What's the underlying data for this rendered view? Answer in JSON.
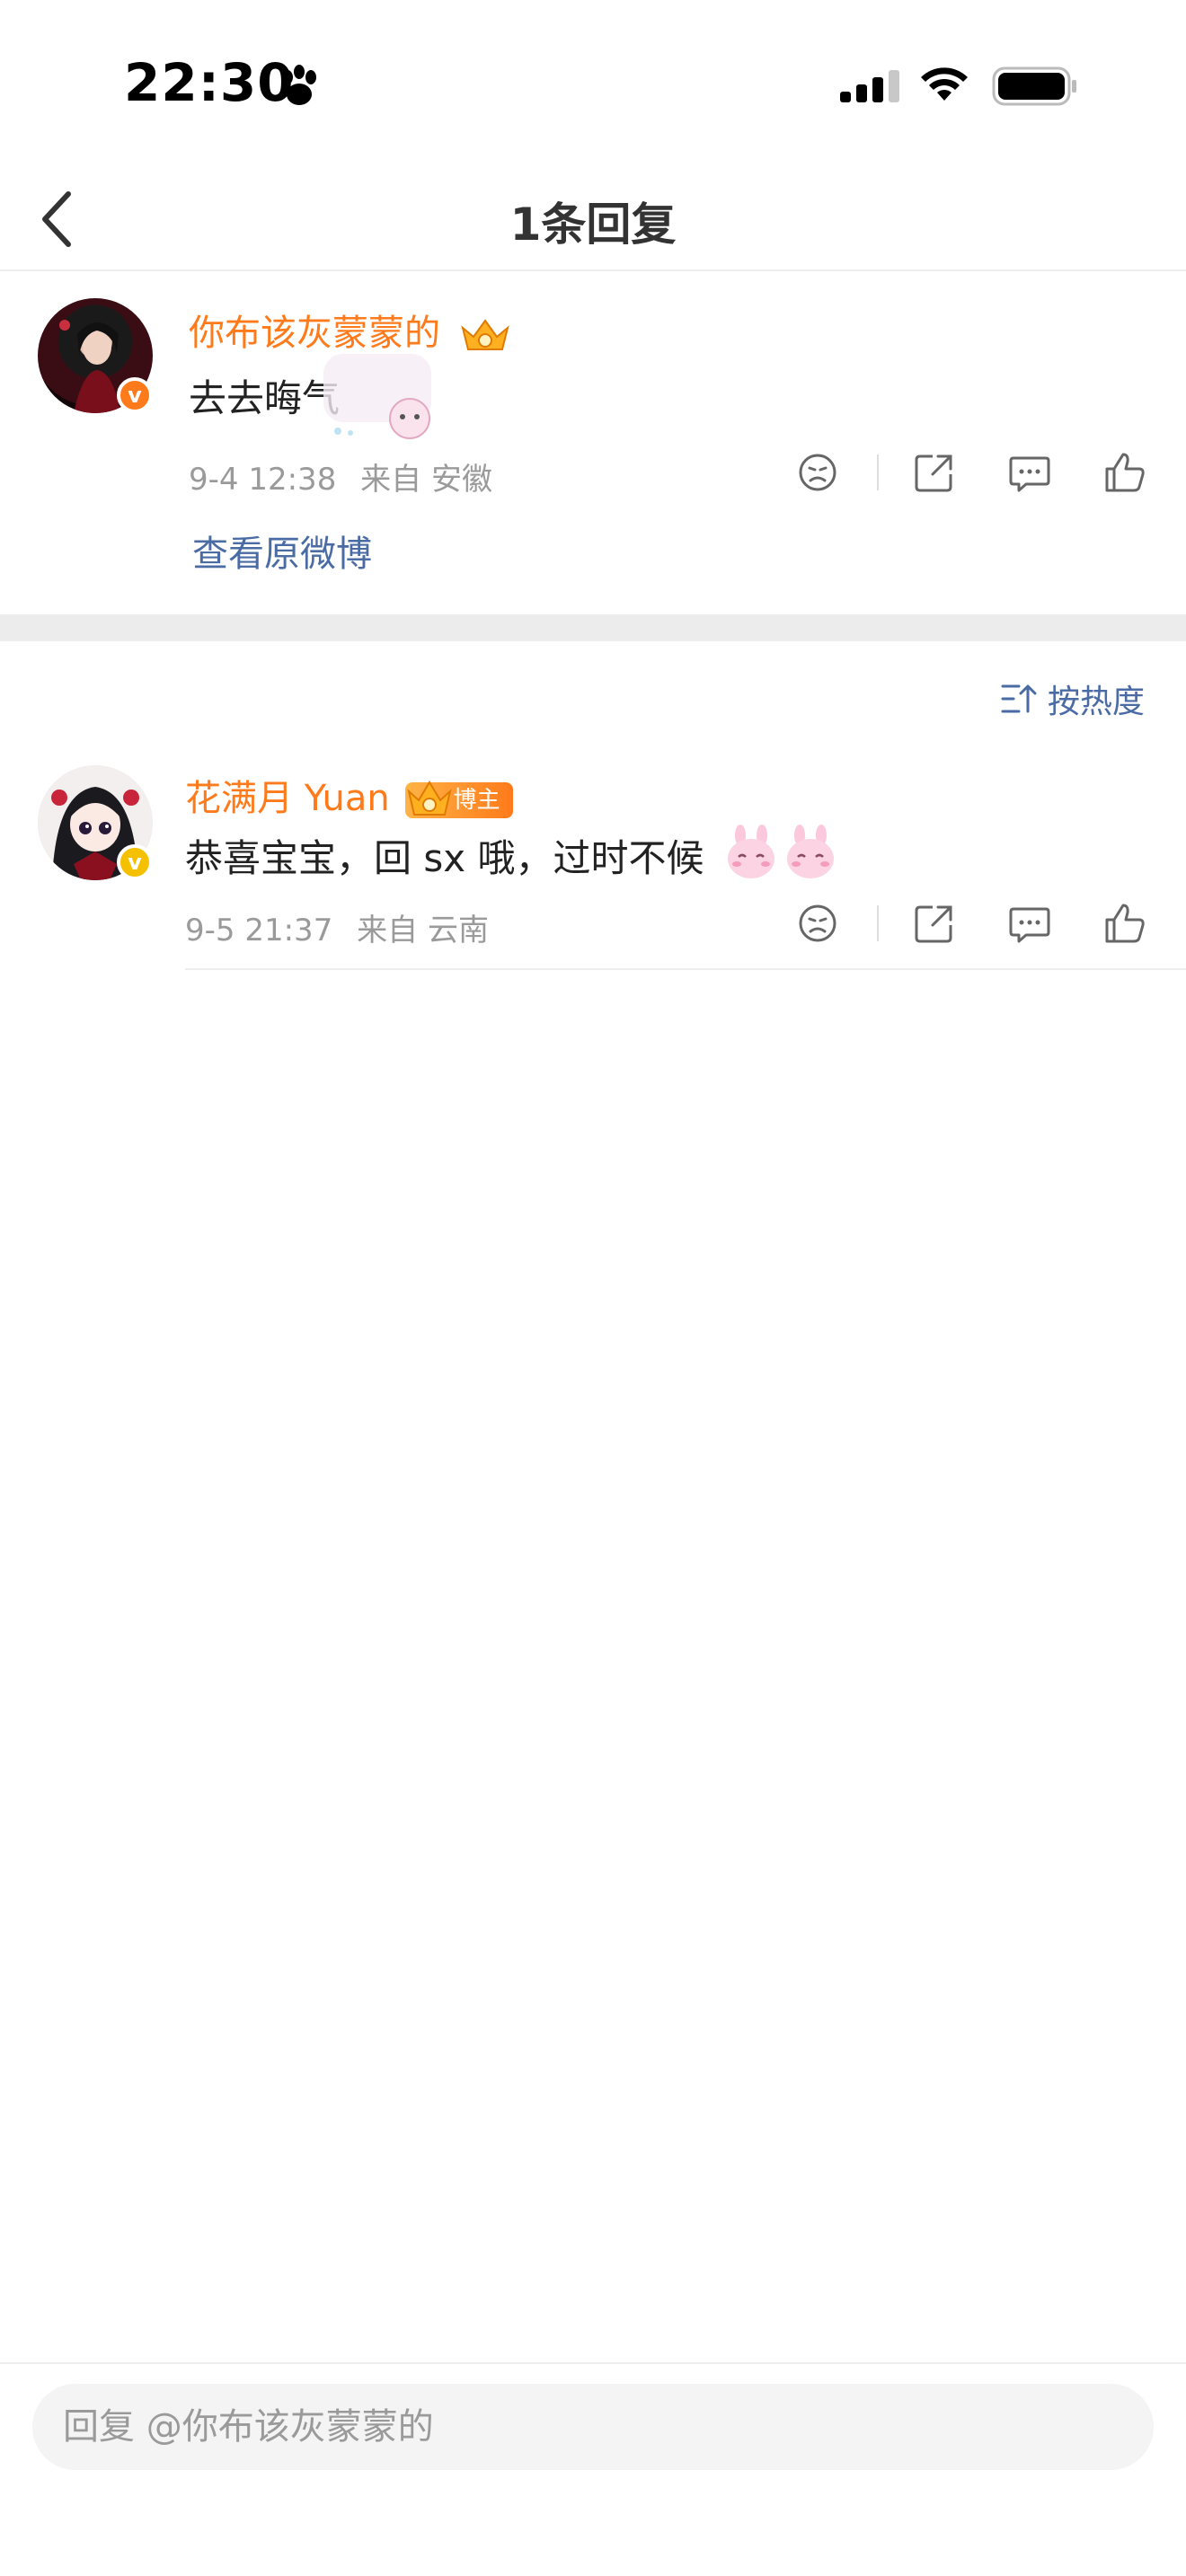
{
  "status_bar": {
    "time": "22:30"
  },
  "header": {
    "title": "1条回复"
  },
  "original_comment": {
    "username": "你布该灰蒙蒙的",
    "text": "去去晦气",
    "date": "9-4 12:38",
    "location": "来自 安徽",
    "view_original": "查看原微博"
  },
  "sort": {
    "label": "按热度"
  },
  "reply": {
    "username": "花满月 Yuan",
    "badge": "博主",
    "text": "恭喜宝宝，回 sx 哦，过时不候",
    "date": "9-5 21:37",
    "location": "来自 云南"
  },
  "reply_box": {
    "placeholder": "回复 @你布该灰蒙蒙的"
  },
  "colors": {
    "accent": "#ff7a1a",
    "link": "#4a6ba3"
  }
}
